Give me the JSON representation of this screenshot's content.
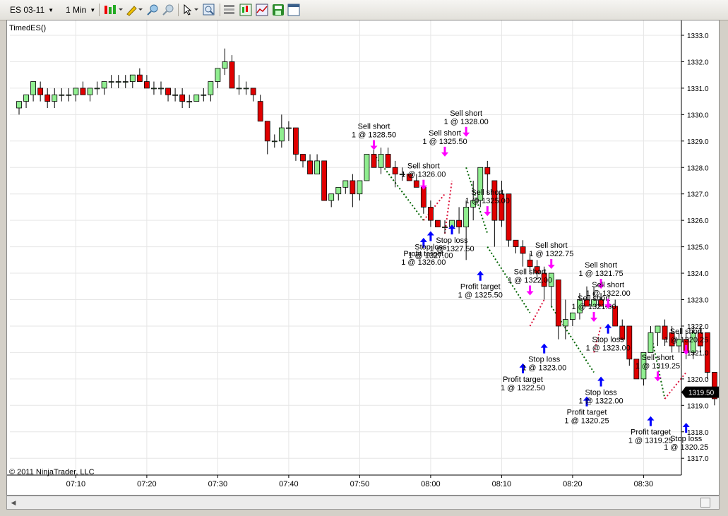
{
  "toolbar": {
    "instrument": "ES 03-11",
    "interval": "1 Min",
    "icons": [
      "bar-type-icon",
      "drawing-pencil-icon",
      "zoom-in-icon",
      "zoom-out-icon",
      "pointer-icon",
      "data-box-icon",
      "chart-properties-icon",
      "strategies-icon",
      "indicators-icon",
      "save-icon",
      "window-icon"
    ]
  },
  "chart_data": {
    "type": "candlestick",
    "indicator_label": "TimedES()",
    "copyright": "© 2011 NinjaTrader, LLC",
    "price_axis": {
      "min": 1316.5,
      "max": 1333.6,
      "ticks": [
        1317.0,
        1318.0,
        1319.0,
        1320.0,
        1321.0,
        1322.0,
        1323.0,
        1324.0,
        1325.0,
        1326.0,
        1327.0,
        1328.0,
        1329.0,
        1330.0,
        1331.0,
        1332.0,
        1333.0
      ]
    },
    "time_axis": {
      "ticks": [
        "07:10",
        "07:20",
        "07:30",
        "07:40",
        "07:50",
        "08:00",
        "08:10",
        "08:20",
        "08:30"
      ],
      "first_tick_bar": 8,
      "bars_per_tick": 10
    },
    "current_price": "1319.50",
    "colors": {
      "up": "#90ee90",
      "down": "#e00000",
      "buy_arrow": "#0000ff",
      "sell_arrow": "#ff00ff",
      "profit_line": "#006400",
      "loss_line": "#dc143c"
    },
    "bars": [
      [
        1330.25,
        1330.5,
        1330.0,
        1330.5
      ],
      [
        1330.5,
        1330.75,
        1330.25,
        1330.75
      ],
      [
        1330.75,
        1331.25,
        1330.5,
        1331.25
      ],
      [
        1331.0,
        1331.25,
        1330.5,
        1330.75
      ],
      [
        1330.75,
        1331.0,
        1330.25,
        1330.5
      ],
      [
        1330.5,
        1331.0,
        1330.25,
        1330.75
      ],
      [
        1330.75,
        1331.0,
        1330.5,
        1330.75
      ],
      [
        1330.75,
        1331.0,
        1330.5,
        1330.75
      ],
      [
        1330.75,
        1331.0,
        1330.5,
        1331.0
      ],
      [
        1331.0,
        1331.25,
        1330.75,
        1330.75
      ],
      [
        1330.75,
        1331.0,
        1330.5,
        1331.0
      ],
      [
        1331.0,
        1331.25,
        1330.75,
        1331.0
      ],
      [
        1331.0,
        1331.25,
        1330.75,
        1331.25
      ],
      [
        1331.25,
        1331.5,
        1331.0,
        1331.25
      ],
      [
        1331.25,
        1331.5,
        1331.0,
        1331.25
      ],
      [
        1331.25,
        1331.5,
        1331.0,
        1331.25
      ],
      [
        1331.25,
        1331.5,
        1331.0,
        1331.5
      ],
      [
        1331.5,
        1331.75,
        1331.25,
        1331.25
      ],
      [
        1331.25,
        1331.5,
        1331.0,
        1331.0
      ],
      [
        1331.0,
        1331.25,
        1330.75,
        1331.0
      ],
      [
        1331.0,
        1331.25,
        1330.75,
        1331.0
      ],
      [
        1331.0,
        1331.0,
        1330.5,
        1330.75
      ],
      [
        1330.75,
        1331.0,
        1330.5,
        1330.75
      ],
      [
        1330.75,
        1331.0,
        1330.25,
        1330.5
      ],
      [
        1330.5,
        1330.75,
        1330.25,
        1330.5
      ],
      [
        1330.5,
        1330.75,
        1330.5,
        1330.75
      ],
      [
        1330.75,
        1331.0,
        1330.5,
        1330.75
      ],
      [
        1330.75,
        1331.0,
        1330.5,
        1331.25
      ],
      [
        1331.25,
        1331.75,
        1331.0,
        1331.75
      ],
      [
        1331.75,
        1332.5,
        1331.5,
        1332.0
      ],
      [
        1332.0,
        1332.25,
        1331.0,
        1331.0
      ],
      [
        1331.0,
        1331.5,
        1330.75,
        1331.0
      ],
      [
        1331.0,
        1331.25,
        1330.75,
        1331.0
      ],
      [
        1331.0,
        1331.0,
        1330.5,
        1330.75
      ],
      [
        1330.5,
        1330.75,
        1329.75,
        1329.75
      ],
      [
        1329.75,
        1329.75,
        1328.5,
        1329.0
      ],
      [
        1329.0,
        1329.25,
        1328.75,
        1329.0
      ],
      [
        1329.0,
        1330.0,
        1328.75,
        1329.5
      ],
      [
        1329.5,
        1329.75,
        1329.0,
        1329.5
      ],
      [
        1329.5,
        1329.5,
        1328.25,
        1328.5
      ],
      [
        1328.5,
        1328.5,
        1328.0,
        1328.25
      ],
      [
        1328.25,
        1328.5,
        1327.75,
        1327.75
      ],
      [
        1327.75,
        1328.5,
        1327.75,
        1328.25
      ],
      [
        1328.25,
        1328.25,
        1326.75,
        1326.75
      ],
      [
        1326.75,
        1327.0,
        1326.5,
        1327.0
      ],
      [
        1327.0,
        1327.25,
        1326.75,
        1327.25
      ],
      [
        1327.25,
        1327.5,
        1327.0,
        1327.5
      ],
      [
        1327.5,
        1327.75,
        1326.5,
        1327.0
      ],
      [
        1327.0,
        1327.5,
        1326.75,
        1327.5
      ],
      [
        1327.5,
        1328.5,
        1327.5,
        1328.5
      ],
      [
        1328.5,
        1328.75,
        1328.0,
        1328.0
      ],
      [
        1328.0,
        1328.75,
        1327.75,
        1328.5
      ],
      [
        1328.5,
        1328.75,
        1328.0,
        1328.0
      ],
      [
        1328.0,
        1328.25,
        1327.25,
        1327.75
      ],
      [
        1327.75,
        1328.0,
        1327.5,
        1327.75
      ],
      [
        1327.75,
        1327.75,
        1327.5,
        1327.5
      ],
      [
        1327.5,
        1327.75,
        1327.25,
        1327.25
      ],
      [
        1327.25,
        1327.25,
        1326.25,
        1326.5
      ],
      [
        1326.5,
        1326.75,
        1325.75,
        1326.0
      ],
      [
        1326.0,
        1326.0,
        1325.75,
        1325.75
      ],
      [
        1325.75,
        1326.0,
        1325.5,
        1325.75
      ],
      [
        1325.75,
        1326.0,
        1325.5,
        1326.0
      ],
      [
        1326.0,
        1326.5,
        1325.5,
        1325.75
      ],
      [
        1325.75,
        1326.75,
        1324.5,
        1326.5
      ],
      [
        1326.5,
        1327.5,
        1326.0,
        1326.75
      ],
      [
        1326.75,
        1328.0,
        1326.5,
        1328.0
      ],
      [
        1328.0,
        1328.25,
        1327.0,
        1327.75
      ],
      [
        1327.5,
        1327.5,
        1325.0,
        1326.0
      ],
      [
        1327.0,
        1327.5,
        1325.75,
        1326.0
      ],
      [
        1327.0,
        1327.0,
        1325.0,
        1325.25
      ],
      [
        1325.25,
        1325.25,
        1324.75,
        1325.0
      ],
      [
        1325.0,
        1325.25,
        1324.25,
        1324.75
      ],
      [
        1324.5,
        1324.75,
        1324.0,
        1324.25
      ],
      [
        1324.25,
        1324.5,
        1323.75,
        1324.0
      ],
      [
        1324.0,
        1324.25,
        1323.0,
        1323.5
      ],
      [
        1323.5,
        1324.0,
        1322.75,
        1324.0
      ],
      [
        1323.75,
        1323.75,
        1321.5,
        1322.0
      ],
      [
        1322.0,
        1323.0,
        1321.5,
        1322.25
      ],
      [
        1322.25,
        1322.5,
        1322.0,
        1322.5
      ],
      [
        1322.5,
        1323.25,
        1322.25,
        1323.0
      ],
      [
        1323.0,
        1323.5,
        1322.75,
        1322.75
      ],
      [
        1322.75,
        1323.5,
        1322.75,
        1323.0
      ],
      [
        1323.0,
        1323.25,
        1322.75,
        1322.75
      ],
      [
        1322.75,
        1323.0,
        1322.75,
        1322.75
      ],
      [
        1322.75,
        1323.0,
        1322.0,
        1322.0
      ],
      [
        1322.0,
        1322.25,
        1321.5,
        1321.5
      ],
      [
        1322.0,
        1322.0,
        1320.5,
        1320.75
      ],
      [
        1320.75,
        1320.75,
        1320.0,
        1320.0
      ],
      [
        1320.0,
        1321.0,
        1319.75,
        1321.0
      ],
      [
        1321.0,
        1322.0,
        1321.0,
        1321.75
      ],
      [
        1321.75,
        1322.0,
        1321.25,
        1322.0
      ],
      [
        1322.0,
        1322.25,
        1321.25,
        1321.5
      ],
      [
        1321.75,
        1322.0,
        1321.0,
        1321.25
      ],
      [
        1321.25,
        1321.75,
        1321.0,
        1321.5
      ],
      [
        1321.5,
        1321.75,
        1320.75,
        1321.0
      ],
      [
        1321.0,
        1322.0,
        1320.75,
        1321.75
      ],
      [
        1321.75,
        1322.0,
        1321.0,
        1321.25
      ],
      [
        1321.75,
        1321.75,
        1320.0,
        1320.25
      ],
      [
        1320.25,
        1320.25,
        1319.0,
        1319.25
      ],
      [
        1319.25,
        1319.5,
        1318.0,
        1318.75
      ],
      [
        1318.75,
        1319.0,
        1318.5,
        1319.0
      ],
      [
        1319.0,
        1319.5,
        1318.75,
        1319.25
      ],
      [
        1319.25,
        1319.75,
        1319.0,
        1319.5
      ],
      [
        1319.5,
        1320.0,
        1319.25,
        1319.75
      ],
      [
        1320.0,
        1320.25,
        1318.75,
        1319.5
      ]
    ],
    "trades": [
      {
        "entry_bar": 50,
        "entry_price": 1328.5,
        "exit_bar": 57,
        "exit_price": 1326.0,
        "result": "profit"
      },
      {
        "entry_bar": 57,
        "entry_price": 1326.0,
        "exit_bar": 60,
        "exit_price": 1327.0,
        "result": "loss"
      },
      {
        "entry_bar": 60,
        "entry_price": 1325.5,
        "exit_bar": 61,
        "exit_price": 1327.5,
        "result": "loss"
      },
      {
        "entry_bar": 63,
        "entry_price": 1328.0,
        "exit_bar": 66,
        "exit_price": 1325.5,
        "result": "profit"
      },
      {
        "entry_bar": 66,
        "entry_price": 1325.0,
        "exit_bar": 72,
        "exit_price": 1322.5,
        "result": "profit"
      },
      {
        "entry_bar": 72,
        "entry_price": 1322.0,
        "exit_bar": 74,
        "exit_price": 1323.0,
        "result": "loss"
      },
      {
        "entry_bar": 75,
        "entry_price": 1322.75,
        "exit_bar": 81,
        "exit_price": 1320.25,
        "result": "profit"
      },
      {
        "entry_bar": 81,
        "entry_price": 1321.0,
        "exit_bar": 82,
        "exit_price": 1322.0,
        "result": "loss"
      },
      {
        "entry_bar": 89,
        "entry_price": 1321.75,
        "exit_bar": 91,
        "exit_price": 1319.25,
        "result": "profit"
      },
      {
        "entry_bar": 91,
        "entry_price": 1319.25,
        "exit_bar": 94,
        "exit_price": 1320.25,
        "result": "loss"
      }
    ],
    "markers": [
      {
        "bar": 50,
        "side": "sell",
        "price": 1328.5,
        "text": [
          "Sell short",
          "1 @ 1328.50"
        ]
      },
      {
        "bar": 57,
        "side": "sell",
        "price": 1327.0,
        "text": [
          "Sell short",
          "1 @ 1326.00"
        ]
      },
      {
        "bar": 57,
        "side": "buy",
        "price": 1325.5,
        "text": [
          "Profit target",
          "1 @ 1326.00"
        ]
      },
      {
        "bar": 58,
        "side": "buy",
        "price": 1325.75,
        "text": [
          "Stop loss",
          "1 @ 1327.00"
        ]
      },
      {
        "bar": 60,
        "side": "sell",
        "price": 1328.25,
        "text": [
          "Sell short",
          "1 @ 1325.50"
        ]
      },
      {
        "bar": 61,
        "side": "buy",
        "price": 1326.0,
        "text": [
          "Stop loss",
          "1 @ 1327.50"
        ]
      },
      {
        "bar": 63,
        "side": "sell",
        "price": 1329.0,
        "text": [
          "Sell short",
          "1 @ 1328.00"
        ]
      },
      {
        "bar": 66,
        "side": "sell",
        "price": 1326.0,
        "text": [
          "Sell short",
          "1 @ 1325.00"
        ]
      },
      {
        "bar": 65,
        "side": "buy",
        "price": 1324.25,
        "text": [
          "Profit target",
          "1 @ 1325.50"
        ]
      },
      {
        "bar": 72,
        "side": "sell",
        "price": 1323.0,
        "text": [
          "Sell short",
          "1 @ 1322.00"
        ]
      },
      {
        "bar": 71,
        "side": "buy",
        "price": 1320.75,
        "text": [
          "Profit target",
          "1 @ 1322.50"
        ]
      },
      {
        "bar": 74,
        "side": "buy",
        "price": 1321.5,
        "text": [
          "Stop loss",
          "1 @ 1323.00"
        ]
      },
      {
        "bar": 75,
        "side": "sell",
        "price": 1324.0,
        "text": [
          "Sell short",
          "1 @ 1322.75"
        ]
      },
      {
        "bar": 80,
        "side": "buy",
        "price": 1319.5,
        "text": [
          "Profit target",
          "1 @ 1320.25"
        ]
      },
      {
        "bar": 81,
        "side": "sell",
        "price": 1322.0,
        "text": [
          "Sell short",
          "1 @ 1321.00"
        ]
      },
      {
        "bar": 82,
        "side": "buy",
        "price": 1320.25,
        "text": [
          "Stop loss",
          "1 @ 1322.00"
        ]
      },
      {
        "bar": 82,
        "side": "sell",
        "price": 1323.25,
        "text": [
          "Sell short",
          "1 @ 1321.75"
        ]
      },
      {
        "bar": 83,
        "side": "buy",
        "price": 1322.25,
        "text": [
          "Stop loss",
          "1 @ 1323.00"
        ]
      },
      {
        "bar": 83,
        "side": "sell",
        "price": 1322.5,
        "text": [
          "Sell short",
          "1 @ 1322.00"
        ]
      },
      {
        "bar": 90,
        "side": "sell",
        "price": 1319.75,
        "text": [
          "Sell short",
          "1 @ 1319.25"
        ]
      },
      {
        "bar": 89,
        "side": "buy",
        "price": 1318.75,
        "text": [
          "Profit target",
          "1 @ 1319.25"
        ]
      },
      {
        "bar": 94,
        "side": "sell",
        "price": 1320.75,
        "text": [
          "Sell short",
          "1 @ 1320.25"
        ]
      },
      {
        "bar": 94,
        "side": "buy",
        "price": 1318.5,
        "text": [
          "Stop loss",
          "1 @ 1320.25"
        ]
      }
    ]
  }
}
